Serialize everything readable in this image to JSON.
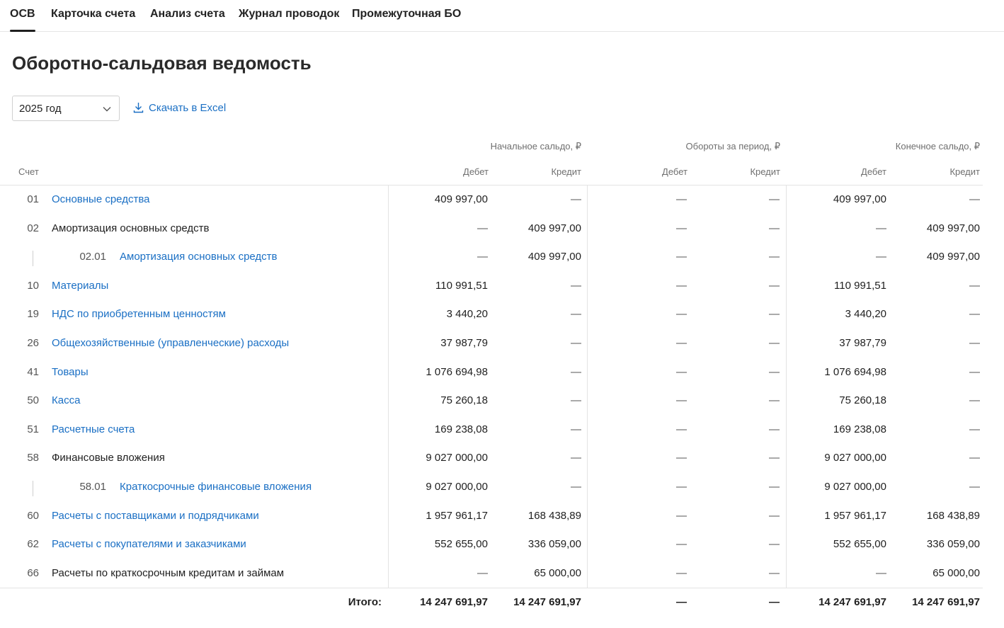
{
  "tabs": [
    {
      "label": "ОСВ",
      "active": true
    },
    {
      "label": "Карточка счета",
      "active": false
    },
    {
      "label": "Анализ счета",
      "active": false
    },
    {
      "label": "Журнал проводок",
      "active": false
    },
    {
      "label": "Промежуточная БО",
      "active": false
    }
  ],
  "title": "Оборотно-сальдовая ведомость",
  "year_select": {
    "value": "2025 год",
    "icon": "chevron-down-icon"
  },
  "excel_link": {
    "label": "Скачать в Excel",
    "icon": "download-icon"
  },
  "accent_color": "#1a6fc4",
  "table": {
    "group_headers": {
      "opening": "Начальное сальдо, ₽",
      "turnover": "Обороты за период, ₽",
      "closing": "Конечное сальдо, ₽"
    },
    "col_headers": {
      "account": "Счет",
      "debit": "Дебет",
      "credit": "Кредит"
    },
    "rows": [
      {
        "code": "01",
        "name": "Основные средства",
        "link": true,
        "sub": false,
        "values": [
          "409 997,00",
          "—",
          "—",
          "—",
          "409 997,00",
          "—"
        ]
      },
      {
        "code": "02",
        "name": "Амортизация основных средств",
        "link": false,
        "sub": false,
        "values": [
          "—",
          "409 997,00",
          "—",
          "—",
          "—",
          "409 997,00"
        ]
      },
      {
        "code": "02.01",
        "name": "Амортизация основных средств",
        "link": true,
        "sub": true,
        "values": [
          "—",
          "409 997,00",
          "—",
          "—",
          "—",
          "409 997,00"
        ]
      },
      {
        "code": "10",
        "name": "Материалы",
        "link": true,
        "sub": false,
        "values": [
          "110 991,51",
          "—",
          "—",
          "—",
          "110 991,51",
          "—"
        ]
      },
      {
        "code": "19",
        "name": "НДС по приобретенным ценностям",
        "link": true,
        "sub": false,
        "values": [
          "3 440,20",
          "—",
          "—",
          "—",
          "3 440,20",
          "—"
        ]
      },
      {
        "code": "26",
        "name": "Общехозяйственные (управленческие) расходы",
        "link": true,
        "sub": false,
        "values": [
          "37 987,79",
          "—",
          "—",
          "—",
          "37 987,79",
          "—"
        ]
      },
      {
        "code": "41",
        "name": "Товары",
        "link": true,
        "sub": false,
        "values": [
          "1 076 694,98",
          "—",
          "—",
          "—",
          "1 076 694,98",
          "—"
        ]
      },
      {
        "code": "50",
        "name": "Касса",
        "link": true,
        "sub": false,
        "values": [
          "75 260,18",
          "—",
          "—",
          "—",
          "75 260,18",
          "—"
        ]
      },
      {
        "code": "51",
        "name": "Расчетные счета",
        "link": true,
        "sub": false,
        "values": [
          "169 238,08",
          "—",
          "—",
          "—",
          "169 238,08",
          "—"
        ]
      },
      {
        "code": "58",
        "name": "Финансовые вложения",
        "link": false,
        "sub": false,
        "values": [
          "9 027 000,00",
          "—",
          "—",
          "—",
          "9 027 000,00",
          "—"
        ]
      },
      {
        "code": "58.01",
        "name": "Краткосрочные финансовые вложения",
        "link": true,
        "sub": true,
        "values": [
          "9 027 000,00",
          "—",
          "—",
          "—",
          "9 027 000,00",
          "—"
        ]
      },
      {
        "code": "60",
        "name": "Расчеты с поставщиками и подрядчиками",
        "link": true,
        "sub": false,
        "values": [
          "1 957 961,17",
          "168 438,89",
          "—",
          "—",
          "1 957 961,17",
          "168 438,89"
        ]
      },
      {
        "code": "62",
        "name": "Расчеты с покупателями и заказчиками",
        "link": true,
        "sub": false,
        "values": [
          "552 655,00",
          "336 059,00",
          "—",
          "—",
          "552 655,00",
          "336 059,00"
        ]
      },
      {
        "code": "66",
        "name": "Расчеты по краткосрочным кредитам и займам",
        "link": false,
        "sub": false,
        "values": [
          "—",
          "65 000,00",
          "—",
          "—",
          "—",
          "65 000,00"
        ]
      }
    ],
    "total": {
      "label": "Итого:",
      "values": [
        "14 247 691,97",
        "14 247 691,97",
        "—",
        "—",
        "14 247 691,97",
        "14 247 691,97"
      ]
    }
  }
}
